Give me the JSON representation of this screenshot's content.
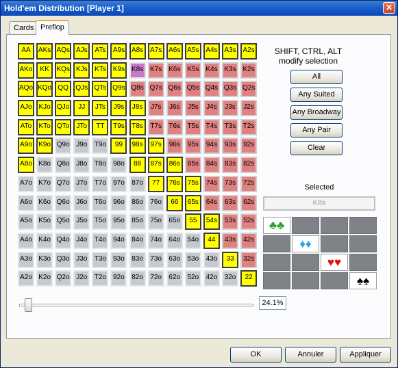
{
  "window": {
    "title": "Hold'em Distribution [Player 1]",
    "close_symbol": "✕"
  },
  "tabs": [
    {
      "label": "Cards"
    },
    {
      "label": "Preflop"
    }
  ],
  "hand_matrix": {
    "rows": [
      [
        "AA",
        "AKs",
        "AQs",
        "AJs",
        "ATs",
        "A9s",
        "A8s",
        "A7s",
        "A6s",
        "A5s",
        "A4s",
        "A3s",
        "A2s"
      ],
      [
        "AKo",
        "KK",
        "KQs",
        "KJs",
        "KTs",
        "K9s",
        "K8s",
        "K7s",
        "K6s",
        "K5s",
        "K4s",
        "K3s",
        "K2s"
      ],
      [
        "AQo",
        "KQo",
        "QQ",
        "QJs",
        "QTs",
        "Q9s",
        "Q8s",
        "Q7s",
        "Q6s",
        "Q5s",
        "Q4s",
        "Q3s",
        "Q2s"
      ],
      [
        "AJo",
        "KJo",
        "QJo",
        "JJ",
        "JTs",
        "J9s",
        "J8s",
        "J7s",
        "J6s",
        "J5s",
        "J4s",
        "J3s",
        "J2s"
      ],
      [
        "ATo",
        "KTo",
        "QTo",
        "JTo",
        "TT",
        "T9s",
        "T8s",
        "T7s",
        "T6s",
        "T5s",
        "T4s",
        "T3s",
        "T2s"
      ],
      [
        "A9o",
        "K9o",
        "Q9o",
        "J9o",
        "T9o",
        "99",
        "98s",
        "97s",
        "96s",
        "95s",
        "94s",
        "93s",
        "92s"
      ],
      [
        "A8o",
        "K8o",
        "Q8o",
        "J8o",
        "T8o",
        "98o",
        "88",
        "87s",
        "86s",
        "85s",
        "84s",
        "83s",
        "82s"
      ],
      [
        "A7o",
        "K7o",
        "Q7o",
        "J7o",
        "T7o",
        "97o",
        "87o",
        "77",
        "76s",
        "75s",
        "74s",
        "73s",
        "72s"
      ],
      [
        "A6o",
        "K6o",
        "Q6o",
        "J6o",
        "T6o",
        "96o",
        "86o",
        "76o",
        "66",
        "65s",
        "64s",
        "63s",
        "62s"
      ],
      [
        "A5o",
        "K5o",
        "Q5o",
        "J5o",
        "T5o",
        "95o",
        "85o",
        "75o",
        "65o",
        "55",
        "54s",
        "53s",
        "52s"
      ],
      [
        "A4o",
        "K4o",
        "Q4o",
        "J4o",
        "T4o",
        "94o",
        "84o",
        "74o",
        "64o",
        "54o",
        "44",
        "43s",
        "42s"
      ],
      [
        "A3o",
        "K3o",
        "Q3o",
        "J3o",
        "T3o",
        "93o",
        "83o",
        "73o",
        "63o",
        "53o",
        "43o",
        "33",
        "32s"
      ],
      [
        "A2o",
        "K2o",
        "Q2o",
        "J2o",
        "T2o",
        "92o",
        "82o",
        "72o",
        "62o",
        "52o",
        "42o",
        "32o",
        "22"
      ]
    ],
    "selected_hands": [
      "AA",
      "AKs",
      "AQs",
      "AJs",
      "ATs",
      "A9s",
      "A8s",
      "A7s",
      "A6s",
      "A5s",
      "A4s",
      "A3s",
      "A2s",
      "AKo",
      "KK",
      "KQs",
      "KJs",
      "KTs",
      "K9s",
      "AQo",
      "KQo",
      "QQ",
      "QJs",
      "QTs",
      "Q9s",
      "AJo",
      "KJo",
      "QJo",
      "JJ",
      "JTs",
      "J9s",
      "J8s",
      "ATo",
      "KTo",
      "QTo",
      "JTo",
      "TT",
      "T9s",
      "T8s",
      "A9o",
      "K9o",
      "99",
      "98s",
      "97s",
      "A8o",
      "88",
      "87s",
      "86s",
      "77",
      "76s",
      "75s",
      "66",
      "65s",
      "55",
      "54s",
      "44",
      "33",
      "22"
    ],
    "current_hand": "K8s",
    "colors": {
      "selected": "#ffff00",
      "suited": "#e08080",
      "offsuit": "#c4cad0",
      "current": "#c779c7"
    }
  },
  "modifier_hint": "SHIFT, CTRL, ALT\nmodify selection",
  "quick_buttons": [
    {
      "label": "All"
    },
    {
      "label": "Any Suited"
    },
    {
      "label": "Any Broadway"
    },
    {
      "label": "Any Pair"
    },
    {
      "label": "Clear"
    }
  ],
  "selected": {
    "label": "Selected",
    "value": "K8s"
  },
  "suit_matrix": {
    "rows": [
      [
        {
          "symbol": "♣♣",
          "color": "#2e9c2e",
          "on": true
        },
        {
          "symbol": "",
          "color": "",
          "on": false
        },
        {
          "symbol": "",
          "color": "",
          "on": false
        },
        {
          "symbol": "",
          "color": "",
          "on": false
        }
      ],
      [
        {
          "symbol": "",
          "color": "",
          "on": false
        },
        {
          "symbol": "♦♦",
          "color": "#29a3e8",
          "on": true
        },
        {
          "symbol": "",
          "color": "",
          "on": false
        },
        {
          "symbol": "",
          "color": "",
          "on": false
        }
      ],
      [
        {
          "symbol": "",
          "color": "",
          "on": false
        },
        {
          "symbol": "",
          "color": "",
          "on": false
        },
        {
          "symbol": "♥♥",
          "color": "#e01010",
          "on": true
        },
        {
          "symbol": "",
          "color": "",
          "on": false
        }
      ],
      [
        {
          "symbol": "",
          "color": "",
          "on": false
        },
        {
          "symbol": "",
          "color": "",
          "on": false
        },
        {
          "symbol": "",
          "color": "",
          "on": false
        },
        {
          "symbol": "♠♠",
          "color": "#000000",
          "on": true
        }
      ]
    ]
  },
  "range_slider": {
    "percent_text": "24.1%",
    "level": 0.02
  },
  "footer": {
    "ok": "OK",
    "cancel": "Annuler",
    "apply": "Appliquer"
  }
}
